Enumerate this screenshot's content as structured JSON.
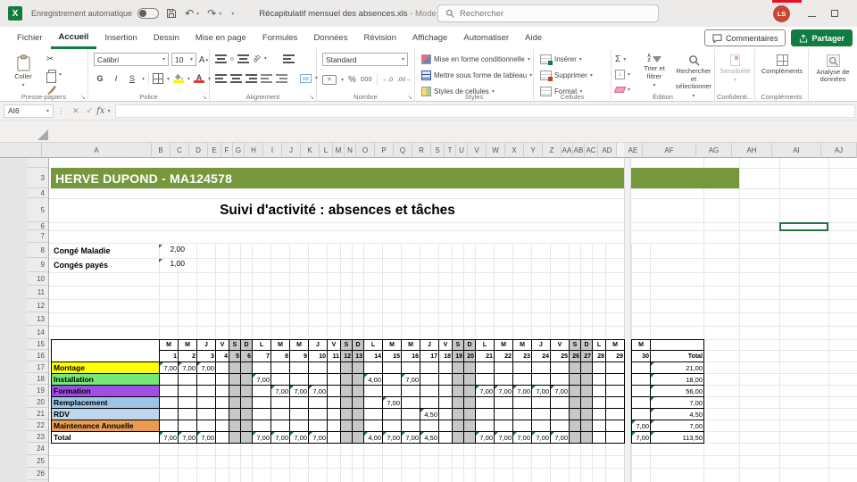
{
  "title_bar": {
    "autosave_label": "Enregistrement automatique",
    "doc_title": "Récapitulatif mensuel des absences.xls",
    "doc_mode": " - Mode de compati...",
    "search_placeholder": "Rechercher",
    "avatar_initials": "LS"
  },
  "tabs": [
    "Fichier",
    "Accueil",
    "Insertion",
    "Dessin",
    "Mise en page",
    "Formules",
    "Données",
    "Révision",
    "Affichage",
    "Automatiser",
    "Aide"
  ],
  "active_tab": "Accueil",
  "top_actions": {
    "comments": "Commentaires",
    "share": "Partager"
  },
  "ribbon": {
    "clipboard": {
      "label": "Presse-papiers",
      "paste": "Coller"
    },
    "font": {
      "label": "Police",
      "family": "Calibri",
      "size": "10",
      "bold": "G",
      "italic": "I",
      "underline": "S"
    },
    "alignment": {
      "label": "Alignement",
      "orientation": "ab"
    },
    "number": {
      "label": "Nombre",
      "format": "Standard",
      "currency": "¤",
      "percent": "%",
      "thousands": "000",
      "dec_more": "←,0",
      "dec_less": ",00→"
    },
    "styles": {
      "label": "Styles",
      "items": [
        "Mise en forme conditionnelle",
        "Mettre sous forme de tableau",
        "Styles de cellules"
      ]
    },
    "cells": {
      "label": "Cellules",
      "items": [
        "Insérer",
        "Supprimer",
        "Format"
      ]
    },
    "editing": {
      "label": "Édition",
      "sum": "Σ",
      "sort": "Trier et filtrer",
      "find": "Rechercher et sélectionner"
    },
    "sensitivity": {
      "label": "Confidenti...",
      "button": "Sensibilité"
    },
    "addins": {
      "label": "Compléments",
      "button": "Compléments"
    },
    "analyze": {
      "button": "Analyse de données"
    }
  },
  "formula_bar": {
    "name_box": "AI6",
    "fx": "fx"
  },
  "sheet": {
    "column_headers": [
      "A",
      "B",
      "C",
      "D",
      "E",
      "F",
      "G",
      "H",
      "I",
      "J",
      "K",
      "L",
      "M",
      "N",
      "O",
      "P",
      "Q",
      "R",
      "S",
      "T",
      "U",
      "V",
      "W",
      "X",
      "Y",
      "Z",
      "AA",
      "AB",
      "AC",
      "AD",
      "AE",
      "AF",
      "AG",
      "AH",
      "AI",
      "AJ"
    ],
    "row_headers": [
      3,
      4,
      5,
      6,
      7,
      8,
      9,
      10,
      11,
      12,
      13,
      14,
      15,
      16,
      17,
      18,
      19,
      20,
      21,
      22,
      23,
      24,
      25,
      26
    ],
    "banner": "HERVE DUPOND -  MA124578",
    "title": "Suivi d'activité : absences et tâches",
    "summary": [
      {
        "label": "Congé Maladie",
        "value": "2,00"
      },
      {
        "label": "Congés payés",
        "value": "1,00"
      }
    ],
    "selection": "AI6",
    "table": {
      "day_letters": [
        "M",
        "M",
        "J",
        "V",
        "S",
        "D",
        "L",
        "M",
        "M",
        "J",
        "V",
        "S",
        "D",
        "L",
        "M",
        "M",
        "J",
        "V",
        "S",
        "D",
        "L",
        "M",
        "M",
        "J",
        "V",
        "S",
        "D",
        "L",
        "M"
      ],
      "day_numbers": [
        1,
        2,
        3,
        4,
        5,
        6,
        7,
        8,
        9,
        10,
        11,
        12,
        13,
        14,
        15,
        16,
        17,
        18,
        19,
        20,
        21,
        22,
        23,
        24,
        25,
        26,
        27,
        28,
        29
      ],
      "weekend_days": [
        5,
        6,
        12,
        13,
        19,
        20,
        26,
        27
      ],
      "day30_letter": "M",
      "day30_number": "30",
      "total_header": "Total",
      "rows": [
        {
          "label": "Montage",
          "color": "#FFFF00",
          "values": {
            "1": "7,00",
            "2": "7,00",
            "3": "7,00"
          },
          "day30": "",
          "total": "21,00"
        },
        {
          "label": "Installation",
          "color": "#75E975",
          "values": {
            "7": "7,00",
            "14": "4,00",
            "16": "7,00"
          },
          "day30": "",
          "total": "18,00"
        },
        {
          "label": "Formation",
          "color": "#A04FE6",
          "values": {
            "8": "7,00",
            "9": "7,00",
            "10": "7,00",
            "21": "7,00",
            "22": "7,00",
            "23": "7,00",
            "24": "7,00",
            "25": "7,00"
          },
          "day30": "",
          "total": "56,00"
        },
        {
          "label": "Remplacement",
          "color": "#9DC3E6",
          "values": {
            "15": "7,00"
          },
          "day30": "",
          "total": "7,00"
        },
        {
          "label": "RDV",
          "color": "#BDD7EE",
          "values": {
            "17": "4,50"
          },
          "day30": "",
          "total": "4,50"
        },
        {
          "label": "Maintenance Annuelle",
          "color": "#EB9C50",
          "values": {},
          "day30": "7,00",
          "total": "7,00"
        },
        {
          "label": "Total",
          "color": "#FFFFFF",
          "is_total": true,
          "values": {
            "1": "7,00",
            "2": "7,00",
            "3": "7,00",
            "7": "7,00",
            "8": "7,00",
            "9": "7,00",
            "10": "7,00",
            "14": "4,00",
            "15": "7,00",
            "16": "7,00",
            "17": "4,50",
            "21": "7,00",
            "22": "7,00",
            "23": "7,00",
            "24": "7,00",
            "25": "7,00"
          },
          "day30": "7,00",
          "total": "113,50"
        }
      ]
    }
  },
  "colors": {
    "accent_green": "#107C41",
    "banner_green": "#76973B",
    "weekend_gray": "#C7C7C7",
    "selection_green": "#217346",
    "avatar_red": "#C74634"
  }
}
